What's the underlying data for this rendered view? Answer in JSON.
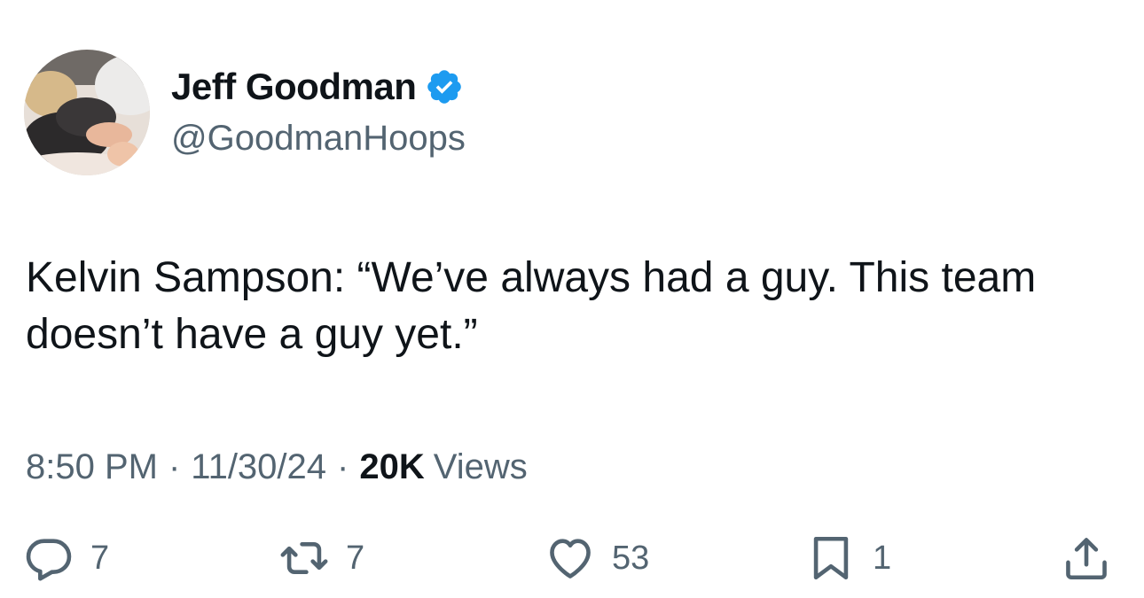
{
  "author": {
    "display_name": "Jeff Goodman",
    "handle": "@GoodmanHoops",
    "verified": true,
    "verified_color": "#1d9bf0"
  },
  "tweet": {
    "text": "Kelvin Sampson: “We’ve always had a guy. This team doesn’t have a guy yet.”"
  },
  "meta": {
    "time": "8:50 PM",
    "separator": "·",
    "date": "11/30/24",
    "views_count": "20K",
    "views_label": "Views"
  },
  "actions": {
    "reply": {
      "icon": "reply-icon",
      "count": "7"
    },
    "retweet": {
      "icon": "retweet-icon",
      "count": "7"
    },
    "like": {
      "icon": "heart-icon",
      "count": "53"
    },
    "bookmark": {
      "icon": "bookmark-icon",
      "count": "1"
    },
    "share": {
      "icon": "share-icon"
    }
  },
  "colors": {
    "text_primary": "#0f1419",
    "text_secondary": "#536471",
    "background": "#ffffff"
  }
}
